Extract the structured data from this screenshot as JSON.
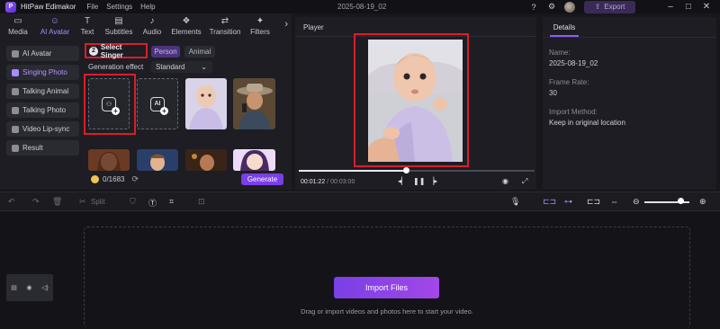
{
  "app": {
    "name": "HitPaw Edimakor",
    "menu": [
      "File",
      "Settings",
      "Help"
    ],
    "file_title": "2025-08-19_02",
    "export_label": "Export"
  },
  "toolbar": {
    "tools": [
      "Media",
      "AI Avatar",
      "Text",
      "Subtitles",
      "Audio",
      "Elements",
      "Transition",
      "Filters"
    ],
    "active_tool": "AI Avatar"
  },
  "sidebar": {
    "items": [
      "AI Avatar",
      "Singing Photo",
      "Talking Animal",
      "Talking Photo",
      "Video Lip-sync",
      "Result"
    ],
    "active_item": "Singing Photo"
  },
  "singer": {
    "step_number": "2",
    "step_label": "Select Singer",
    "tabs": [
      "Person",
      "Animal"
    ],
    "active_tab": "Person",
    "generation_effect_label": "Generation effect",
    "generation_effect_value": "Standard",
    "credits": "0/1683",
    "generate_label": "Generate"
  },
  "player": {
    "title": "Player",
    "current_time": "00:01:22",
    "total_time": "00:03:00",
    "progress": 0.455
  },
  "details": {
    "tab": "Details",
    "fields": [
      {
        "label": "Name:",
        "value": "2025-08-19_02"
      },
      {
        "label": "Frame Rate:",
        "value": "30"
      },
      {
        "label": "Import Method:",
        "value": "Keep in original location"
      }
    ]
  },
  "timeline": {
    "split_label": "Split",
    "import_label": "Import Files",
    "drag_hint": "Drag or import videos and photos here to start your video.",
    "zoom_level": 0.8
  },
  "colors": {
    "accent": "#8f5cf7",
    "highlight_frame": "#d91e2c",
    "generate": "#7a3fe6"
  }
}
